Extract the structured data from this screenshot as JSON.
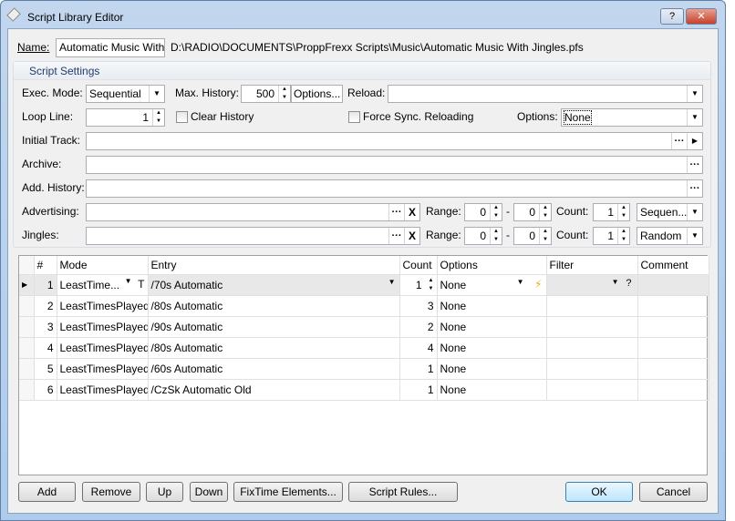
{
  "window": {
    "title": "Script Library Editor",
    "help_icon": "help-icon",
    "close_icon": "close-icon"
  },
  "name": {
    "label": "Name:",
    "value": "Automatic Music With Ji",
    "path": "D:\\RADIO\\DOCUMENTS\\ProppFrexx Scripts\\Music\\Automatic Music With Jingles.pfs"
  },
  "settings": {
    "group_title": "Script Settings",
    "exec_mode_label": "Exec. Mode:",
    "exec_mode": "Sequential",
    "max_history_label": "Max. History:",
    "max_history": "500",
    "options_button": "Options...",
    "reload_label": "Reload:",
    "reload": "",
    "loop_line_label": "Loop Line:",
    "loop_line": "1",
    "clear_history": "Clear History",
    "clear_history_checked": false,
    "force_sync": "Force Sync. Reloading",
    "force_sync_checked": false,
    "options_label": "Options:",
    "options": "None",
    "initial_track_label": "Initial Track:",
    "archive_label": "Archive:",
    "add_history_label": "Add. History:",
    "advertising_label": "Advertising:",
    "jingles_label": "Jingles:",
    "range_label": "Range:",
    "dash": "-",
    "count_label": "Count:",
    "ellipsis": "···",
    "clear_x": "X",
    "advertising": {
      "range_from": "0",
      "range_to": "0",
      "count": "1",
      "mode": "Sequen..."
    },
    "jingles": {
      "range_from": "0",
      "range_to": "0",
      "count": "1",
      "mode": "Random"
    }
  },
  "grid": {
    "columns": [
      "#",
      "Mode",
      "Entry",
      "Count",
      "Options",
      "Filter",
      "Comment"
    ],
    "rows": [
      {
        "n": "1",
        "mode": "LeastTime...",
        "entry": "/70s Automatic",
        "count": "1",
        "options": "None",
        "filter": "",
        "comment": ""
      },
      {
        "n": "2",
        "mode": "LeastTimesPlayed",
        "entry": "/80s Automatic",
        "count": "3",
        "options": "None",
        "filter": "",
        "comment": ""
      },
      {
        "n": "3",
        "mode": "LeastTimesPlayed",
        "entry": "/90s Automatic",
        "count": "2",
        "options": "None",
        "filter": "",
        "comment": ""
      },
      {
        "n": "4",
        "mode": "LeastTimesPlayed",
        "entry": "/80s Automatic",
        "count": "4",
        "options": "None",
        "filter": "",
        "comment": ""
      },
      {
        "n": "5",
        "mode": "LeastTimesPlayed",
        "entry": "/60s Automatic",
        "count": "1",
        "options": "None",
        "filter": "",
        "comment": ""
      },
      {
        "n": "6",
        "mode": "LeastTimesPlayed",
        "entry": "/CzSk Automatic Old",
        "count": "1",
        "options": "None",
        "filter": "",
        "comment": ""
      }
    ],
    "t_button": "T",
    "q_button": "?"
  },
  "buttons": {
    "add": "Add",
    "remove": "Remove",
    "up": "Up",
    "down": "Down",
    "fixtime": "FixTime Elements...",
    "rules": "Script Rules...",
    "ok": "OK",
    "cancel": "Cancel"
  }
}
